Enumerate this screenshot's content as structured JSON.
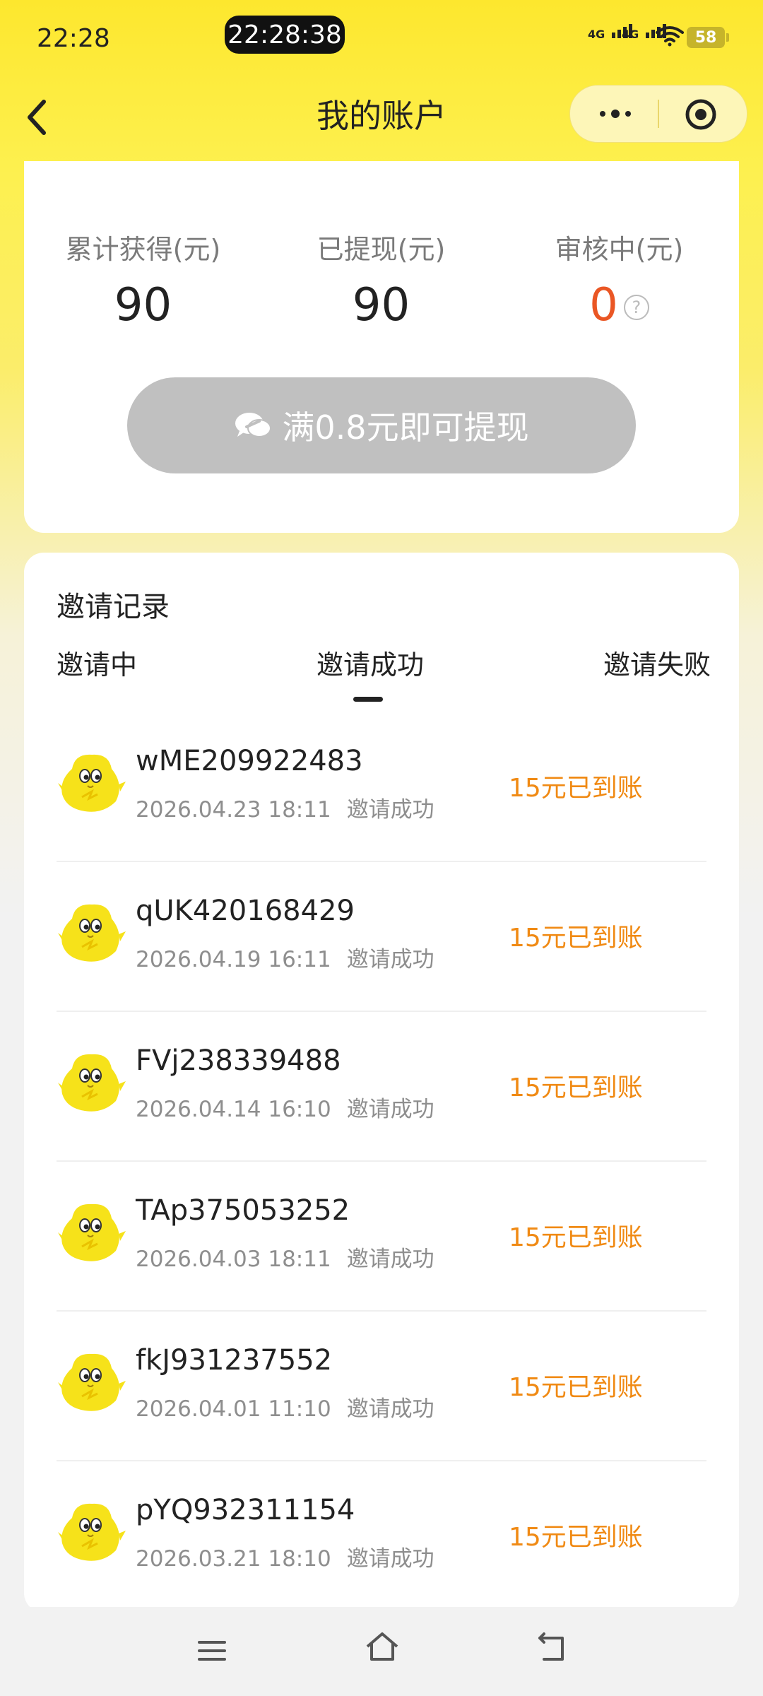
{
  "status_bar": {
    "time": "22:28",
    "recording_time": "22:28:38",
    "signal_1": "4G",
    "signal_2": "4G",
    "battery": "58"
  },
  "nav": {
    "title": "我的账户"
  },
  "balance": {
    "stats": [
      {
        "label": "累计获得(元)",
        "value": "90"
      },
      {
        "label": "已提现(元)",
        "value": "90"
      },
      {
        "label": "审核中(元)",
        "value": "0",
        "help": "?"
      }
    ],
    "withdraw_label": "满0.8元即可提现"
  },
  "invite": {
    "section_title": "邀请记录",
    "tabs": [
      "邀请中",
      "邀请成功",
      "邀请失败"
    ],
    "active_tab": "邀请成功",
    "records": [
      {
        "name": "wME209922483",
        "time": "2026.04.23 18:11",
        "status": "邀请成功",
        "reward": "15元已到账"
      },
      {
        "name": "qUK420168429",
        "time": "2026.04.19 16:11",
        "status": "邀请成功",
        "reward": "15元已到账"
      },
      {
        "name": "FVj238339488",
        "time": "2026.04.14 16:10",
        "status": "邀请成功",
        "reward": "15元已到账"
      },
      {
        "name": "TAp375053252",
        "time": "2026.04.03 18:11",
        "status": "邀请成功",
        "reward": "15元已到账"
      },
      {
        "name": "fkJ931237552",
        "time": "2026.04.01 11:10",
        "status": "邀请成功",
        "reward": "15元已到账"
      },
      {
        "name": "pYQ932311154",
        "time": "2026.03.21 18:10",
        "status": "邀请成功",
        "reward": "15元已到账"
      }
    ]
  },
  "colors": {
    "header_yellow": "#fde72e",
    "reward_orange": "#f08a14",
    "pending_red": "#ea5624",
    "disabled_button": "#c0c0c0"
  }
}
